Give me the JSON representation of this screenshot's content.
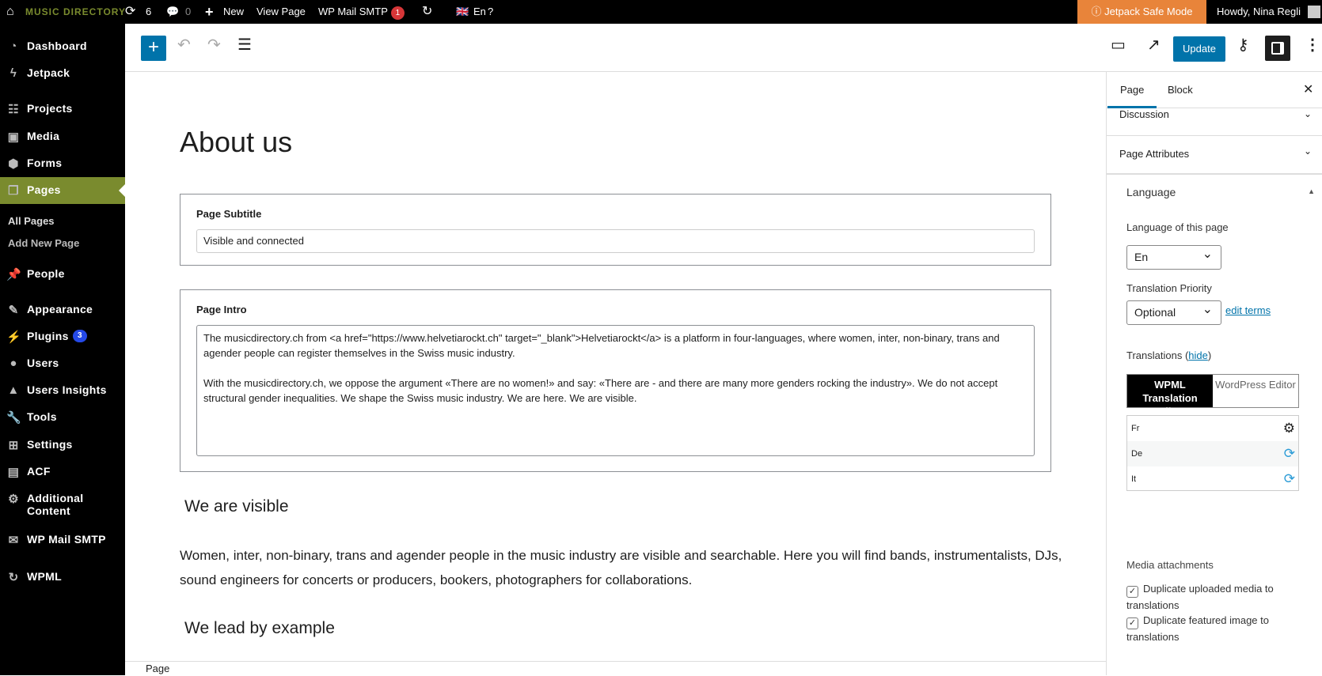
{
  "topbar": {
    "site_name": "MUSIC DIRECTORY",
    "updates": "6",
    "comments": "0",
    "new": "New",
    "view_page": "View Page",
    "wp_mail_smtp": "WP Mail SMTP",
    "smtp_badge": "1",
    "language": "En",
    "jetpack": "Jetpack Safe Mode",
    "howdy": "Howdy, Nina Regli"
  },
  "sidebar": {
    "items": [
      {
        "label": "Dashboard",
        "icon": "dashboard-icon"
      },
      {
        "label": "Jetpack",
        "icon": "jetpack-icon"
      },
      {
        "label": "Projects",
        "icon": "groups-icon"
      },
      {
        "label": "Media",
        "icon": "media-icon"
      },
      {
        "label": "Forms",
        "icon": "forms-icon"
      },
      {
        "label": "Pages",
        "icon": "pages-icon"
      },
      {
        "label": "People",
        "icon": "pin-icon"
      },
      {
        "label": "Appearance",
        "icon": "brush-icon"
      },
      {
        "label": "Plugins",
        "icon": "plugin-icon",
        "badge": "3"
      },
      {
        "label": "Users",
        "icon": "user-icon"
      },
      {
        "label": "Users Insights",
        "icon": "insights-icon"
      },
      {
        "label": "Tools",
        "icon": "wrench-icon"
      },
      {
        "label": "Settings",
        "icon": "settings-icon"
      },
      {
        "label": "ACF",
        "icon": "acf-icon"
      },
      {
        "label": "Additional Content",
        "icon": "gear-icon"
      },
      {
        "label": "WP Mail SMTP",
        "icon": "mail-icon"
      },
      {
        "label": "WPML",
        "icon": "wpml-icon"
      }
    ],
    "submenu": [
      "All Pages",
      "Add New Page"
    ]
  },
  "toolbar": {
    "update": "Update"
  },
  "content": {
    "title": "About us",
    "subtitle_label": "Page Subtitle",
    "subtitle_value": "Visible and connected",
    "intro_label": "Page Intro",
    "intro_value": "The musicdirectory.ch from <a href=\"https://www.helvetiarockt.ch\" target=\"_blank\">Helvetiarockt</a> is a platform in four-languages, where women, inter, non-binary, trans and agender people can register themselves in the Swiss music industry.\n\nWith the musicdirectory.ch, we oppose the argument «There are no women!» and say: «There are - and there are many more genders rocking the industry». We do not accept structural gender inequalities. We shape the Swiss music industry. We are here. We are visible.",
    "h2_1": "We are visible",
    "para_1": "Women, inter, non-binary, trans and agender people in the music industry are visible and searchable. Here you will find bands, instrumentalists, DJs, sound engineers for concerts or producers, bookers, photographers for collaborations.",
    "h2_2": "We lead by example"
  },
  "footer": {
    "breadcrumb": "Page"
  },
  "panel": {
    "tab_page": "Page",
    "tab_block": "Block",
    "discussion": "Discussion",
    "page_attributes": "Page Attributes",
    "language": "Language",
    "lang_of_page": "Language of this page",
    "lang_value": "En",
    "priority_label": "Translation Priority",
    "priority_value": "Optional",
    "edit_terms": "edit terms",
    "translations": "Translations (",
    "hide": "hide",
    "translations_end": ")",
    "editor_wpml": "WPML Translation Editor",
    "editor_wp": "WordPress Editor",
    "translation_rows": [
      {
        "lang": "Fr",
        "icon": "gear-icon"
      },
      {
        "lang": "De",
        "icon": "refresh-icon"
      },
      {
        "lang": "It",
        "icon": "refresh-icon"
      }
    ],
    "media_attachments": "Media attachments",
    "dup_media": "Duplicate uploaded media to translations",
    "dup_featured": "Duplicate featured image to translations",
    "dup_media_checked": true,
    "dup_featured_checked": true
  }
}
